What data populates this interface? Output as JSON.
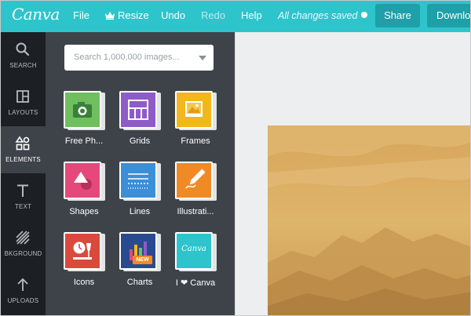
{
  "app": {
    "logo": "Canva"
  },
  "menu": {
    "file": "File",
    "resize": "Resize",
    "undo": "Undo",
    "redo": "Redo",
    "help": "Help",
    "status": "All changes saved",
    "share": "Share",
    "download": "Download"
  },
  "rail": {
    "items": [
      {
        "label": "SEARCH",
        "icon": "search-icon"
      },
      {
        "label": "LAYOUTS",
        "icon": "layouts-icon"
      },
      {
        "label": "ELEMENTS",
        "icon": "elements-icon",
        "active": true
      },
      {
        "label": "TEXT",
        "icon": "text-icon"
      },
      {
        "label": "BKGROUND",
        "icon": "background-icon"
      },
      {
        "label": "UPLOADS",
        "icon": "upload-icon"
      }
    ]
  },
  "panel": {
    "search_placeholder": "Search 1,000,000 images...",
    "tiles": [
      {
        "label": "Free Ph...",
        "icon": "camera-icon",
        "color": "#6fbf5f"
      },
      {
        "label": "Grids",
        "icon": "grid-icon",
        "color": "#8e5bc7"
      },
      {
        "label": "Frames",
        "icon": "frame-icon",
        "color": "#f3b61c"
      },
      {
        "label": "Shapes",
        "icon": "shapes-icon",
        "color": "#e5487b"
      },
      {
        "label": "Lines",
        "icon": "lines-icon",
        "color": "#3b8fd6"
      },
      {
        "label": "Illustrati...",
        "icon": "pencil-icon",
        "color": "#f08a24"
      },
      {
        "label": "Icons",
        "icon": "icons-icon",
        "color": "#d94a3d"
      },
      {
        "label": "Charts",
        "icon": "chart-icon",
        "color": "#2a4a8f",
        "badge": "NEW"
      },
      {
        "label": "I ❤ Canva",
        "icon": "canva-logo-icon",
        "color": "#2ec4cc",
        "inner_text": "Canva"
      }
    ]
  },
  "colors": {
    "topbar": "#2ec4cc",
    "rail": "#1c1f23",
    "panel": "#3e434a",
    "workspace": "#eceef0",
    "design_tone": "#d9ad5f"
  }
}
